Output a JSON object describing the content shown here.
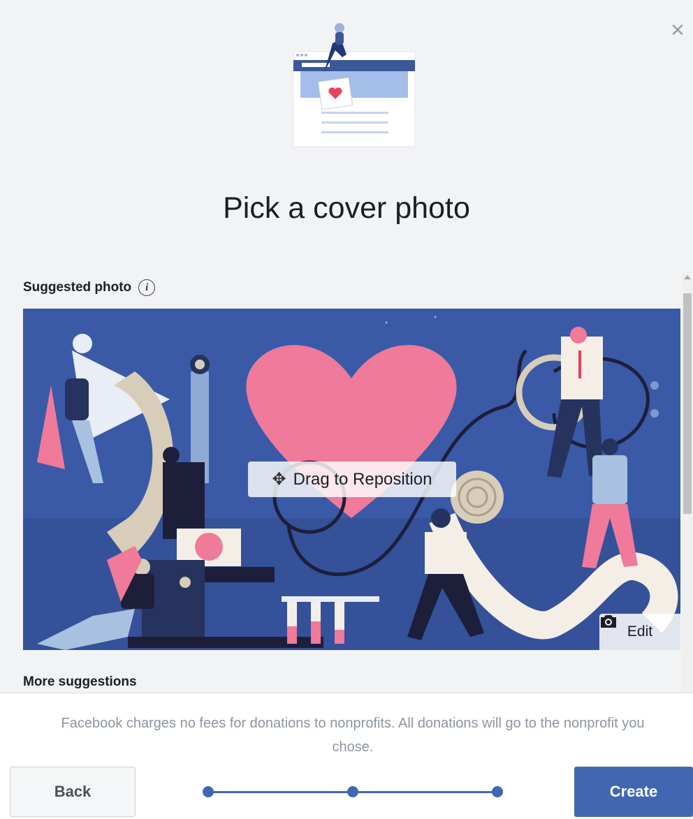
{
  "dialog": {
    "title": "Pick a cover photo",
    "close_icon": "close-icon"
  },
  "suggested": {
    "label": "Suggested photo",
    "info_icon": "info-icon",
    "info_glyph": "i",
    "drag_label": "Drag to Reposition",
    "drag_icon": "✥",
    "edit_label": "Edit",
    "camera_icon": "camera-icon"
  },
  "more": {
    "label": "More suggestions"
  },
  "footer": {
    "note": "Facebook charges no fees for donations to nonprofits. All donations will go to the nonprofit you chose.",
    "back_label": "Back",
    "create_label": "Create",
    "steps_total": 3,
    "steps_complete": 3
  },
  "colors": {
    "accent": "#4267b2",
    "cover_bg": "#3a5aa8",
    "heart": "#ef7a9a",
    "page_bg": "#f2f3f5"
  }
}
